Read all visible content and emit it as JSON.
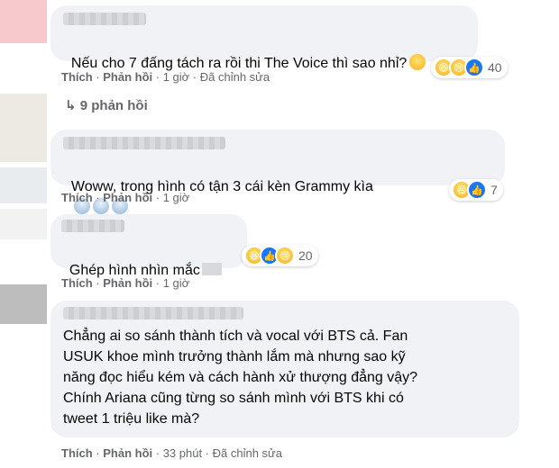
{
  "comments": [
    {
      "text": "Nếu cho 7 đấng tách ra rồi thi The Voice thì sao nhỉ?",
      "trailing_emoji": [
        "grin-sweat"
      ],
      "actions": {
        "like": "Thích",
        "reply": "Phản hồi",
        "time": "1 giờ",
        "edited": "Đã chỉnh sửa"
      },
      "reactions": {
        "types": [
          "haha",
          "sad",
          "like"
        ],
        "count": "40"
      },
      "replies_label": "9 phản hồi"
    },
    {
      "text": "Woww, trong hình có tận 3 cái kèn Grammy kìa",
      "trailing_emoji": [
        "scream",
        "scream",
        "scream"
      ],
      "actions": {
        "like": "Thích",
        "reply": "Phản hồi",
        "time": "1 giờ"
      },
      "reactions": {
        "types": [
          "haha",
          "like"
        ],
        "count": "7"
      }
    },
    {
      "text": "Ghép hình nhìn mắc",
      "actions": {
        "like": "Thích",
        "reply": "Phản hồi",
        "time": "1 giờ"
      },
      "reactions": {
        "types": [
          "haha",
          "like",
          "sad"
        ],
        "count": "20"
      }
    },
    {
      "text": "Chẳng ai so sánh thành tích và vocal với BTS cả. Fan\nUSUK khoe mình trưởng thành lắm mà nhưng sao kỹ\nnăng đọc hiểu kém và cách hành xử thượng đẳng vậy?\nChính Ariana cũng từng so sánh mình với BTS khi có\ntweet 1 triệu like mà?",
      "actions": {
        "like": "Thích",
        "reply": "Phản hồi",
        "time": "33 phút",
        "edited": "Đã chỉnh sửa"
      }
    }
  ],
  "colors": {
    "bubble": "#f0f2f5",
    "meta": "#65676b",
    "like_blue": "#1877f2"
  }
}
